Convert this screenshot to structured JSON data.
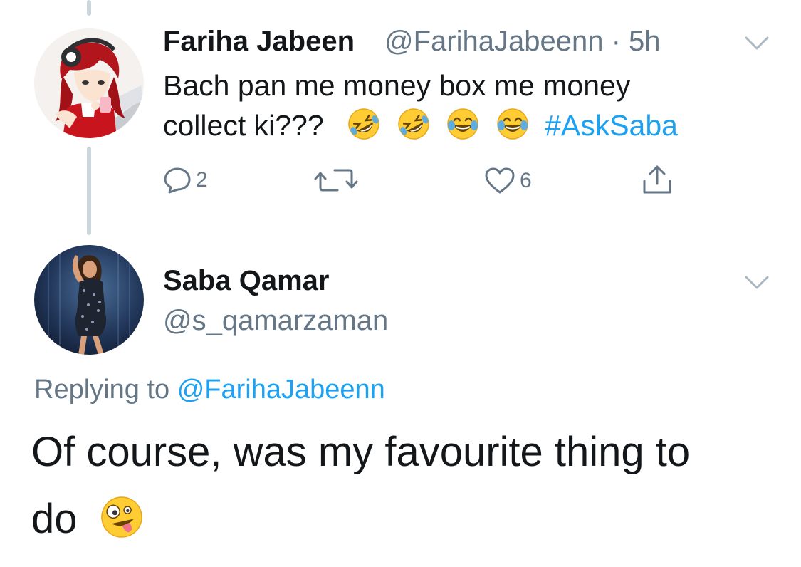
{
  "parent_tweet": {
    "author_name": "Fariha Jabeen",
    "handle": "@FarihaJabeenn",
    "separator": "·",
    "time": "5h",
    "text_line1": "Bach pan me money box me money",
    "text_line2": "collect ki???",
    "emojis": [
      "rolling-on-floor-laughing-emoji",
      "rolling-on-floor-laughing-emoji",
      "tears-of-joy-emoji",
      "tears-of-joy-emoji"
    ],
    "hashtag": "#AskSaba",
    "actions": {
      "reply_count": "2",
      "retweet_count": "",
      "like_count": "6"
    }
  },
  "main_tweet": {
    "author_name": "Saba Qamar",
    "handle": "@s_qamarzaman",
    "replying_prefix": "Replying to",
    "replying_handle": "@FarihaJabeenn",
    "text_line1": "Of course, was my favourite thing to",
    "text_line2": "do",
    "emoji": "zany-face-emoji"
  },
  "colors": {
    "accent": "#1da1f2",
    "secondary_text": "#657786",
    "primary_text": "#14171a",
    "thread_line": "#ccd6dd"
  },
  "icons": [
    "reply-icon",
    "retweet-icon",
    "like-icon",
    "share-icon",
    "chevron-down-icon"
  ]
}
